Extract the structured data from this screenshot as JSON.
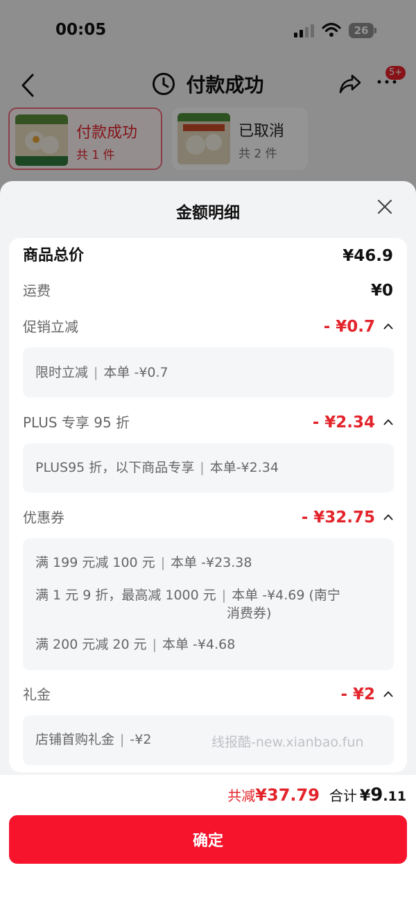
{
  "status_bar": {
    "time": "00:05",
    "battery": "26"
  },
  "nav": {
    "title": "付款成功",
    "more_badge": "5+"
  },
  "order_tabs": [
    {
      "status": "付款成功",
      "count": "共 1 件"
    },
    {
      "status": "已取消",
      "count": "共 2 件"
    }
  ],
  "sheet": {
    "title": "金额明细",
    "goods_total": {
      "label": "商品总价",
      "value": "¥46.9"
    },
    "shipping": {
      "label": "运费",
      "value": "¥0"
    },
    "promo": {
      "label": "促销立减",
      "value": "- ¥0.7",
      "items": [
        {
          "name": "限时立减",
          "detail": "本单 -¥0.7"
        }
      ]
    },
    "plus": {
      "label": "PLUS 专享 95 折",
      "value": "- ¥2.34",
      "items": [
        {
          "name": "PLUS95 折，以下商品专享",
          "detail": "本单-¥2.34"
        }
      ]
    },
    "coupon": {
      "label": "优惠券",
      "value": "- ¥32.75",
      "items": [
        {
          "name": "满 199 元减 100 元",
          "detail": "本单 -¥23.38"
        },
        {
          "name": "满 1 元 9 折，最高减 1000 元",
          "detail": "本单 -¥4.69 (南宁",
          "detail2": "消费券)"
        },
        {
          "name": "满 200 元减 20 元",
          "detail": "本单 -¥4.68"
        }
      ]
    },
    "gift": {
      "label": "礼金",
      "value": "- ¥2",
      "items": [
        {
          "name": "店铺首购礼金",
          "detail": "-¥2"
        }
      ]
    },
    "watermark": "线报酷-new.xianbao.fun"
  },
  "bottom": {
    "reduce_label": "共减",
    "reduce_value": "¥37.79",
    "sum_label": "合计",
    "sum_yen": "¥",
    "sum_int": "9",
    "sum_dec": ".11",
    "confirm_label": "确定"
  },
  "colors": {
    "accent_red": "#e3242b",
    "button_red": "#f5142c"
  },
  "icons": [
    "back-icon",
    "clock-icon",
    "share-icon",
    "more-icon",
    "close-icon",
    "chevron-up-icon",
    "signal-icon",
    "wifi-icon",
    "battery-icon"
  ]
}
